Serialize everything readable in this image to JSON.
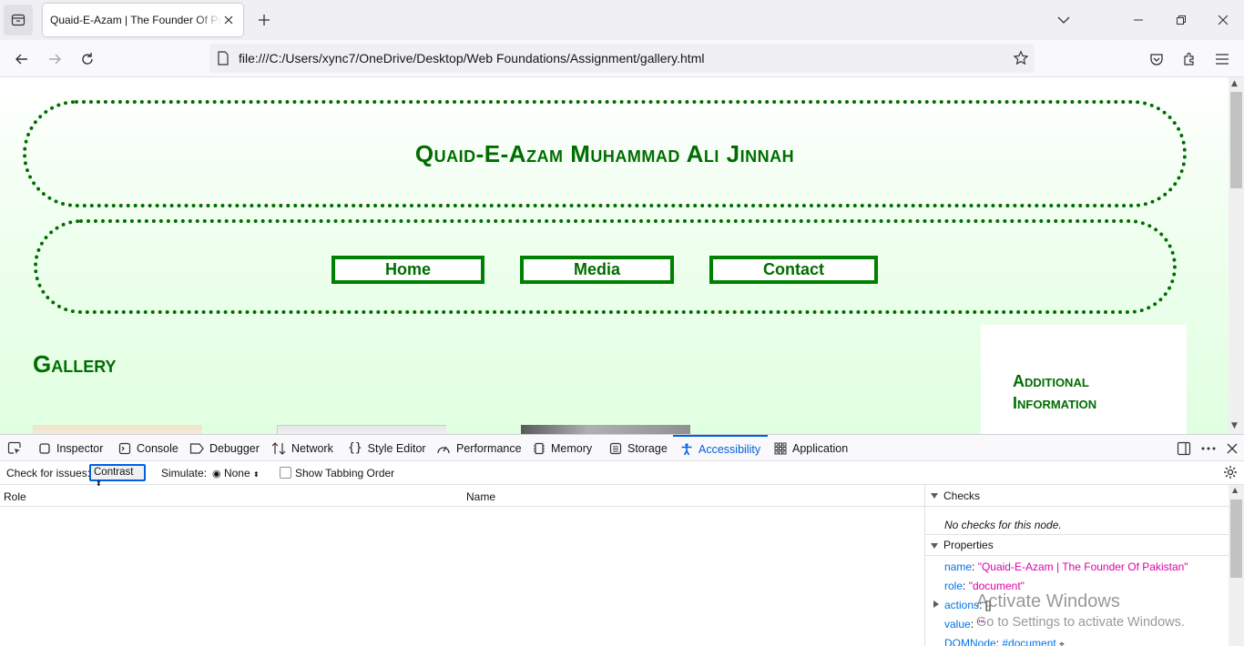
{
  "browser": {
    "tab_title": "Quaid-E-Azam | The Founder Of Pakistan",
    "url": "file:///C:/Users/xync7/OneDrive/Desktop/Web Foundations/Assignment/gallery.html"
  },
  "page": {
    "site_title": "Quaid-E-Azam Muhammad Ali Jinnah",
    "nav": [
      "Home",
      "Media",
      "Contact"
    ],
    "gallery_heading": "Gallery",
    "aside_heading": "Additional Information",
    "theme_color": "#006d00"
  },
  "devtools": {
    "tabs": [
      "Inspector",
      "Console",
      "Debugger",
      "Network",
      "Style Editor",
      "Performance",
      "Memory",
      "Storage",
      "Accessibility",
      "Application"
    ],
    "active_tab": "Accessibility",
    "check_for_issues_label": "Check for issues:",
    "check_for_issues_value": "Contrast",
    "simulate_label": "Simulate:",
    "simulate_value": "None",
    "show_tabbing_label": "Show Tabbing Order",
    "columns": {
      "role": "Role",
      "name": "Name"
    },
    "checks": {
      "heading": "Checks",
      "message": "No checks for this node."
    },
    "properties": {
      "heading": "Properties",
      "items": [
        {
          "key": "name",
          "value": "\"Quaid-E-Azam | The Founder Of Pakistan\""
        },
        {
          "key": "role",
          "value": "\"document\""
        },
        {
          "key": "actions",
          "value": "[]"
        },
        {
          "key": "value",
          "value": "\"\""
        },
        {
          "key": "DOMNode",
          "value": "#document"
        }
      ]
    }
  },
  "os": {
    "watermark_line1": "Activate Windows",
    "watermark_line2": "Go to Settings to activate Windows."
  }
}
